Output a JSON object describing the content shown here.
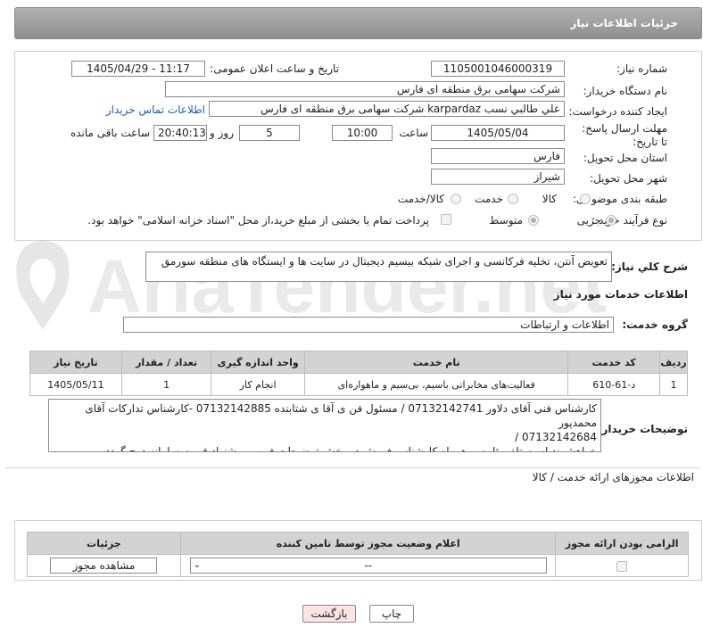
{
  "header": {
    "title": "جزئیات اطلاعات نیاز"
  },
  "watermark": {
    "text": "AriaTender.net"
  },
  "fields": {
    "need_number_label": "شماره نیاز:",
    "need_number": "1105001046000319",
    "announce_label": "تاریخ و ساعت اعلان عمومی:",
    "announce_value": "1405/04/29 - 11:17",
    "buyer_org_label": "نام دستگاه خریدار:",
    "buyer_org": "شرکت سهامی برق منطقه ای فارس",
    "creator_label": "ایجاد کننده درخواست:",
    "creator": "علي طالبي نسب karpardaz شرکت سهامی برق منطقه ای فارس",
    "buyer_contact_link": "اطلاعات تماس خریدار",
    "deadline_label": "مهلت ارسال پاسخ: تا تاریخ:",
    "deadline_date": "1405/05/04",
    "time_label": "ساعت",
    "deadline_time": "10:00",
    "days_value": "5",
    "days_label": "روز و",
    "remaining_time": "20:40:13",
    "remaining_label": "ساعت باقی مانده",
    "province_label": "استان محل تحویل:",
    "province": "فارس",
    "city_label": "شهر محل تحویل:",
    "city": "شیراز",
    "category_label": "طبقه بندی موضوعی:",
    "category_options": [
      "کالا",
      "خدمت",
      "کالا/خدمت"
    ],
    "category_selected": "خدمت",
    "process_label": "نوع فرآیند خرید :",
    "process_options": [
      "جزیی",
      "متوسط"
    ],
    "process_selected": "جزیی",
    "payment_note": "پرداخت تمام یا بخشی از مبلغ خرید،از محل \"اسناد خزانه اسلامی\" خواهد بود."
  },
  "summary": {
    "label": "شرح کلي نیاز:",
    "text": "تعویض آنتن، تخلیه فرکانسی و اجرای شبکه بیسیم دیجیتال در سایت ها و ایستگاه های منطقه سورمق"
  },
  "services": {
    "section_title": "اطلاعات خدمات مورد نیاز",
    "group_label": "گروه خدمت:",
    "group_value": "اطلاعات و ارتباطات",
    "columns": [
      "ردیف",
      "کد خدمت",
      "نام خدمت",
      "واحد اندازه گیری",
      "تعداد / مقدار",
      "تاریخ نیاز"
    ],
    "rows": [
      {
        "row": "1",
        "code": "د-61-610",
        "name": "فعالیت‌های مخابراتی باسیم، بی‌سیم و ماهواره‌ای",
        "unit": "انجام کار",
        "qty": "1",
        "date": "1405/05/11"
      }
    ]
  },
  "buyer_notes": {
    "label": "توضیحات خریدار:",
    "line1": "کارشناس فنی آقای دلاور 07132142741 / مسئول فن ی آقا ی شتابنده 07132142885 -کارشناس تدارکات آقای محمدپور",
    "line2": "07132142684 /",
    "line3": "خواهشمند است تلفن ثابت و همراه کارشناس فروش در بخش توضیحات فرم پ یشنهاد قیمت سامانه درج گردد."
  },
  "permits": {
    "section_title": "اطلاعات مجوزهای ارائه خدمت / کالا",
    "columns": [
      "الزامی بودن ارائه مجوز",
      "اعلام وضعیت مجوز توسط تامین کننده",
      "جزئیات"
    ],
    "select_value": "--",
    "view_button": "مشاهده مجوز"
  },
  "actions": {
    "print": "چاپ",
    "back": "بازگشت"
  }
}
